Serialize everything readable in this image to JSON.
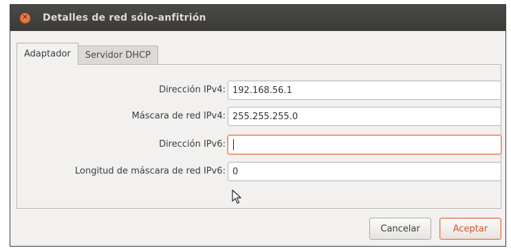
{
  "window": {
    "title": "Detalles de red sólo-anfitrión"
  },
  "tabs": [
    {
      "label": "Adaptador",
      "active": true
    },
    {
      "label": "Servidor DHCP",
      "active": false
    }
  ],
  "form": {
    "ipv4_address": {
      "label": "Dirección IPv4:",
      "value": "192.168.56.1"
    },
    "ipv4_mask": {
      "label": "Máscara de red IPv4:",
      "value": "255.255.255.0"
    },
    "ipv6_address": {
      "label": "Dirección IPv6:",
      "value": ""
    },
    "ipv6_prefix": {
      "label": "Longitud de máscara de red IPv6:",
      "value": "0"
    }
  },
  "buttons": {
    "cancel_label": "Cancelar",
    "accept_label": "Aceptar"
  },
  "icons": {
    "close": "close-icon",
    "pointer": "mouse-pointer-icon"
  },
  "colors": {
    "titlebar": "#3c3b37",
    "close_button": "#e25c24",
    "accent": "#d6542b",
    "window_bg": "#f2f1f0"
  }
}
